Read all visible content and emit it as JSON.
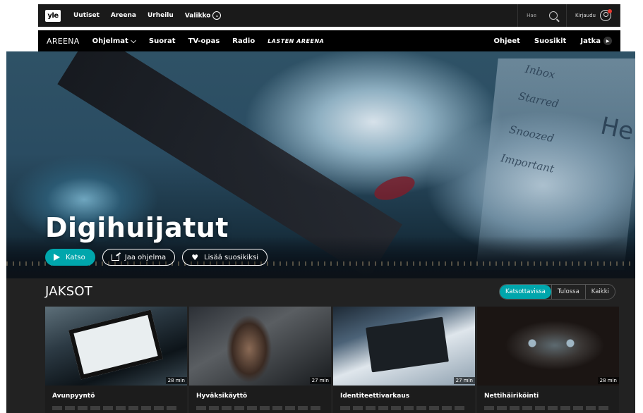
{
  "topbar": {
    "logo": "yle",
    "links": [
      "Uutiset",
      "Areena",
      "Urheilu",
      "Valikko"
    ],
    "search_label": "Hae",
    "login_label": "Kirjaudu"
  },
  "areena_nav": {
    "brand": "AREENA",
    "items": [
      "Ohjelmat",
      "Suorat",
      "TV-opas",
      "Radio",
      "LASTEN AREENA"
    ],
    "right_items": [
      "Ohjeet",
      "Suosikit",
      "Jatka"
    ]
  },
  "hero": {
    "title": "Digihuijatut",
    "play_label": "Katso",
    "share_label": "Jaa ohjelma",
    "favorite_label": "Lisää suosikiksi",
    "screen_words": [
      "Inbox",
      "Starred",
      "Snoozed",
      "Important",
      "He"
    ]
  },
  "episodes": {
    "heading": "JAKSOT",
    "filters": [
      "Katsottavissa",
      "Tulossa",
      "Kaikki"
    ],
    "active_filter": "Katsottavissa",
    "cards": [
      {
        "title": "Avunpyyntö",
        "duration": "28 min"
      },
      {
        "title": "Hyväksikäyttö",
        "duration": "27 min"
      },
      {
        "title": "Identiteettivarkaus",
        "duration": "27 min"
      },
      {
        "title": "Nettihäiriköinti",
        "duration": "28 min"
      }
    ]
  },
  "colors": {
    "accent": "#00a6ac",
    "topbar": "#1a1a1a",
    "nav": "#000000",
    "section": "#222222"
  }
}
